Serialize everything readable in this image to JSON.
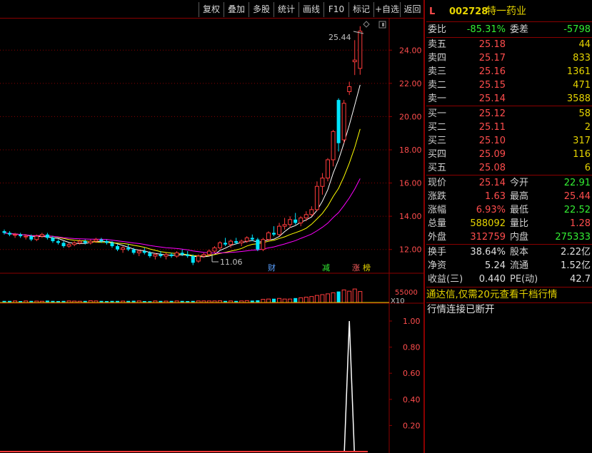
{
  "toolbar": {
    "buttons": [
      "复权",
      "叠加",
      "多股",
      "统计",
      "画线",
      "F10",
      "标记",
      "+自选",
      "返回"
    ]
  },
  "chart": {
    "price_ticks": [
      "24.00",
      "22.00",
      "20.00",
      "18.00",
      "16.00",
      "14.00",
      "12.00"
    ],
    "high_label": "25.44",
    "low_label": "11.06",
    "markers": [
      {
        "text": "财",
        "color": "#5aa0ff"
      },
      {
        "text": "减",
        "color": "#33ee33"
      },
      {
        "text": "涨",
        "color": "#ff6060"
      },
      {
        "text": "榜",
        "color": "#e6d400"
      }
    ],
    "volume_label": "55000",
    "volume_unit": "X10",
    "indicator_ticks": [
      "1.00",
      "0.80",
      "0.60",
      "0.40",
      "0.20"
    ],
    "colors": {
      "up": "#ff3b3b",
      "down": "#00e5ff",
      "ma5": "#ffffff",
      "ma10": "#ffff00",
      "ma20": "#ff00ff",
      "grid": "#8b0000"
    }
  },
  "chart_data": {
    "type": "candlestick",
    "ylim": [
      11,
      25.6
    ],
    "candles": [
      [
        13.1,
        13.2,
        12.9,
        13.0
      ],
      [
        13.0,
        13.1,
        12.8,
        12.9
      ],
      [
        12.9,
        13.0,
        12.7,
        12.9
      ],
      [
        12.9,
        13.0,
        12.7,
        12.8
      ],
      [
        12.8,
        12.9,
        12.6,
        12.8
      ],
      [
        12.8,
        12.9,
        12.5,
        12.6
      ],
      [
        12.6,
        12.9,
        12.5,
        12.8
      ],
      [
        12.8,
        13.0,
        12.7,
        12.9
      ],
      [
        12.9,
        13.0,
        12.6,
        12.7
      ],
      [
        12.7,
        12.8,
        12.4,
        12.5
      ],
      [
        12.5,
        12.6,
        12.3,
        12.4
      ],
      [
        12.4,
        12.5,
        12.1,
        12.2
      ],
      [
        12.2,
        12.4,
        12.1,
        12.3
      ],
      [
        12.3,
        12.5,
        12.2,
        12.4
      ],
      [
        12.4,
        12.6,
        12.3,
        12.5
      ],
      [
        12.5,
        12.6,
        12.3,
        12.4
      ],
      [
        12.4,
        12.6,
        12.3,
        12.5
      ],
      [
        12.5,
        12.7,
        12.4,
        12.6
      ],
      [
        12.6,
        12.7,
        12.4,
        12.5
      ],
      [
        12.5,
        12.6,
        12.3,
        12.4
      ],
      [
        12.4,
        12.5,
        12.1,
        12.2
      ],
      [
        12.2,
        12.3,
        11.9,
        12.0
      ],
      [
        12.0,
        12.2,
        11.8,
        12.1
      ],
      [
        12.1,
        12.3,
        11.9,
        12.0
      ],
      [
        12.0,
        12.1,
        11.7,
        11.8
      ],
      [
        11.8,
        12.0,
        11.6,
        11.9
      ],
      [
        11.9,
        12.1,
        11.7,
        11.8
      ],
      [
        11.8,
        11.9,
        11.5,
        11.6
      ],
      [
        11.6,
        11.8,
        11.4,
        11.7
      ],
      [
        11.7,
        11.9,
        11.5,
        11.6
      ],
      [
        11.6,
        11.8,
        11.4,
        11.7
      ],
      [
        11.7,
        11.8,
        11.5,
        11.6
      ],
      [
        11.6,
        11.9,
        11.5,
        11.8
      ],
      [
        11.8,
        12.0,
        11.6,
        11.7
      ],
      [
        11.7,
        11.9,
        11.5,
        11.6
      ],
      [
        11.6,
        11.7,
        11.06,
        11.2
      ],
      [
        11.3,
        11.7,
        11.2,
        11.6
      ],
      [
        11.6,
        11.8,
        11.5,
        11.7
      ],
      [
        11.7,
        12.0,
        11.6,
        11.9
      ],
      [
        11.9,
        12.2,
        11.8,
        12.1
      ],
      [
        12.1,
        12.5,
        12.0,
        12.4
      ],
      [
        12.4,
        12.7,
        12.2,
        12.3
      ],
      [
        12.3,
        12.6,
        12.1,
        12.5
      ],
      [
        12.5,
        12.7,
        12.3,
        12.4
      ],
      [
        12.4,
        12.6,
        12.2,
        12.5
      ],
      [
        12.5,
        12.8,
        12.4,
        12.7
      ],
      [
        12.7,
        12.9,
        12.5,
        12.6
      ],
      [
        12.6,
        12.7,
        11.9,
        12.0
      ],
      [
        12.0,
        12.7,
        11.9,
        12.6
      ],
      [
        12.6,
        13.1,
        12.5,
        13.0
      ],
      [
        13.0,
        13.4,
        12.8,
        12.9
      ],
      [
        12.9,
        13.6,
        12.8,
        13.4
      ],
      [
        13.4,
        13.9,
        13.2,
        13.5
      ],
      [
        13.5,
        14.0,
        13.3,
        13.8
      ],
      [
        13.8,
        14.2,
        13.5,
        13.6
      ],
      [
        13.6,
        14.0,
        13.4,
        13.9
      ],
      [
        13.9,
        14.3,
        13.7,
        14.1
      ],
      [
        14.1,
        14.6,
        14.0,
        14.4
      ],
      [
        14.4,
        16.1,
        14.3,
        15.8
      ],
      [
        15.8,
        16.6,
        15.3,
        16.3
      ],
      [
        16.3,
        17.5,
        16.1,
        17.4
      ],
      [
        17.4,
        19.2,
        17.0,
        19.1
      ],
      [
        21.0,
        21.1,
        17.9,
        18.4
      ],
      [
        18.6,
        21.0,
        18.4,
        20.8
      ],
      [
        21.5,
        22.1,
        21.3,
        21.8
      ],
      [
        23.3,
        24.6,
        22.5,
        23.4
      ],
      [
        22.9,
        25.44,
        22.52,
        25.14
      ]
    ],
    "volume": [
      0.1,
      0.1,
      0.1,
      0.09,
      0.1,
      0.1,
      0.09,
      0.08,
      0.12,
      0.1,
      0.09,
      0.1,
      0.1,
      0.09,
      0.08,
      0.1,
      0.11,
      0.1,
      0.1,
      0.09,
      0.1,
      0.1,
      0.09,
      0.1,
      0.11,
      0.1,
      0.09,
      0.08,
      0.1,
      0.1,
      0.09,
      0.1,
      0.1,
      0.1,
      0.09,
      0.1,
      0.1,
      0.1,
      0.1,
      0.1,
      0.11,
      0.1,
      0.1,
      0.1,
      0.1,
      0.12,
      0.12,
      0.14,
      0.2,
      0.22,
      0.24,
      0.26,
      0.22,
      0.22,
      0.28,
      0.3,
      0.34,
      0.38,
      0.45,
      0.5,
      0.55,
      0.62,
      0.7,
      0.8,
      0.72,
      0.86,
      0.7
    ],
    "indicator": {
      "ylim": [
        0,
        1.0
      ],
      "spike_index": 64,
      "spike_value": 1.0
    }
  },
  "quote": {
    "code": "002728",
    "name": "特一药业",
    "level": "L",
    "wei_bi_label": "委比",
    "wei_bi": "-85.31%",
    "wei_cha_label": "委差",
    "wei_cha": "-5798",
    "sell": [
      {
        "label": "卖五",
        "price": "25.18",
        "vol": "44"
      },
      {
        "label": "卖四",
        "price": "25.17",
        "vol": "833"
      },
      {
        "label": "卖三",
        "price": "25.16",
        "vol": "1361"
      },
      {
        "label": "卖二",
        "price": "25.15",
        "vol": "471"
      },
      {
        "label": "卖一",
        "price": "25.14",
        "vol": "3588"
      }
    ],
    "buy": [
      {
        "label": "买一",
        "price": "25.12",
        "vol": "58"
      },
      {
        "label": "买二",
        "price": "25.11",
        "vol": "2"
      },
      {
        "label": "买三",
        "price": "25.10",
        "vol": "317"
      },
      {
        "label": "买四",
        "price": "25.09",
        "vol": "116"
      },
      {
        "label": "买五",
        "price": "25.08",
        "vol": "6"
      }
    ],
    "stats": [
      {
        "l1": "现价",
        "v1": "25.14",
        "c1": "red",
        "l2": "今开",
        "v2": "22.91",
        "c2": "green"
      },
      {
        "l1": "涨跌",
        "v1": "1.63",
        "c1": "red",
        "l2": "最高",
        "v2": "25.44",
        "c2": "red"
      },
      {
        "l1": "涨幅",
        "v1": "6.93%",
        "c1": "red",
        "l2": "最低",
        "v2": "22.52",
        "c2": "green"
      },
      {
        "l1": "总量",
        "v1": "588092",
        "c1": "yellow",
        "l2": "量比",
        "v2": "1.28",
        "c2": "red"
      },
      {
        "l1": "外盘",
        "v1": "312759",
        "c1": "red",
        "l2": "内盘",
        "v2": "275333",
        "c2": "green"
      }
    ],
    "fund": [
      {
        "l1": "换手",
        "v1": "38.64%",
        "l2": "股本",
        "v2": "2.22亿"
      },
      {
        "l1": "净资",
        "v1": "5.24",
        "l2": "流通",
        "v2": "1.52亿"
      },
      {
        "l1": "收益(三)",
        "v1": "0.440",
        "l2": "PE(动)",
        "v2": "42.7"
      }
    ],
    "promo": "通达信,仅需20元查看千档行情",
    "status": "行情连接已断开"
  }
}
